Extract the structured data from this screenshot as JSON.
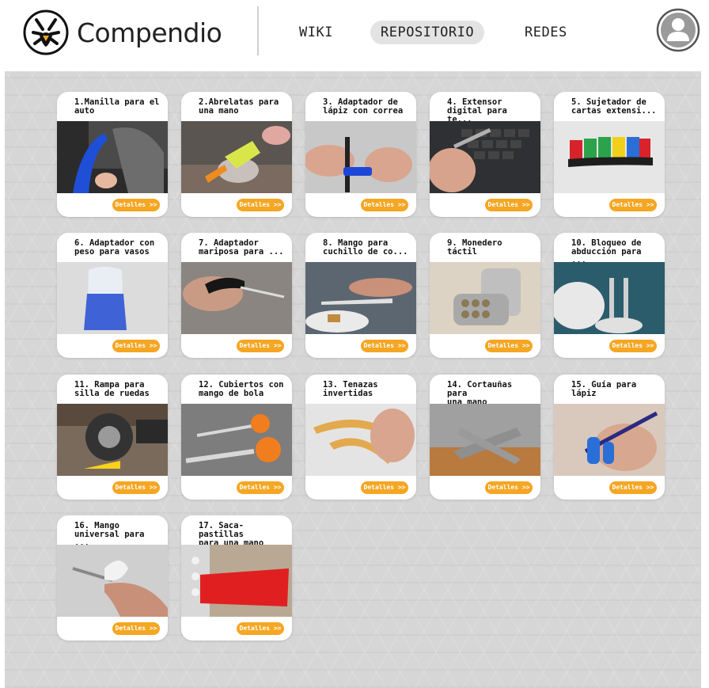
{
  "header": {
    "brand": "Compendio",
    "nav": {
      "wiki": "WIKI",
      "repositorio": "REPOSITORIO",
      "redes": "REDES"
    },
    "active_nav": "REPOSITORIO",
    "icons": {
      "logo": "hand-logo-icon",
      "user": "user-avatar-icon"
    }
  },
  "colors": {
    "accent": "#f5a623",
    "background": "#d6d6d6",
    "card": "#ffffff"
  },
  "cards": [
    {
      "title": "1.Manilla para el\nauto",
      "button": "Detalles >>",
      "photo": "car-handle-photo"
    },
    {
      "title": "2.Abrelatas para\nuna mano",
      "button": "Detalles >>",
      "photo": "can-opener-photo"
    },
    {
      "title": "3. Adaptador de\nlápiz con correa",
      "button": "Detalles >>",
      "photo": "pencil-strap-photo"
    },
    {
      "title": "4. Extensor\ndigital para te...",
      "button": "Detalles >>",
      "photo": "finger-extender-photo"
    },
    {
      "title": "5. Sujetador de\ncartas extensi...",
      "button": "Detalles >>",
      "photo": "card-holder-photo"
    },
    {
      "title": "6. Adaptador con\npeso para vasos",
      "button": "Detalles >>",
      "photo": "weighted-cup-photo"
    },
    {
      "title": "7. Adaptador\nmariposa para ...",
      "button": "Detalles >>",
      "photo": "butterfly-adapter-photo"
    },
    {
      "title": "8. Mango para\ncuchillo de co...",
      "button": "Detalles >>",
      "photo": "knife-handle-photo"
    },
    {
      "title": "9. Monedero táctil",
      "button": "Detalles >>",
      "photo": "coin-purse-photo"
    },
    {
      "title": "10. Bloqueo de\nabducción para ...",
      "button": "Detalles >>",
      "photo": "abduction-block-photo"
    },
    {
      "title": "11. Rampa para\nsilla de ruedas",
      "button": "Detalles >>",
      "photo": "wheelchair-ramp-photo"
    },
    {
      "title": "12. Cubiertos con\nmango de bola",
      "button": "Detalles >>",
      "photo": "ball-cutlery-photo"
    },
    {
      "title": "13. Tenazas\ninvertidas",
      "button": "Detalles >>",
      "photo": "inverted-tongs-photo"
    },
    {
      "title": "14. Cortauñas para\nuna mano",
      "button": "Detalles >>",
      "photo": "nail-clipper-photo"
    },
    {
      "title": "15. Guía para\nlápiz",
      "button": "Detalles >>",
      "photo": "pencil-guide-photo"
    },
    {
      "title": "16. Mango\nuniversal para ...",
      "button": "Detalles >>",
      "photo": "universal-handle-photo"
    },
    {
      "title": "17. Saca-pastillas\npara una mano",
      "button": "Detalles >>",
      "photo": "pill-popper-photo"
    }
  ]
}
